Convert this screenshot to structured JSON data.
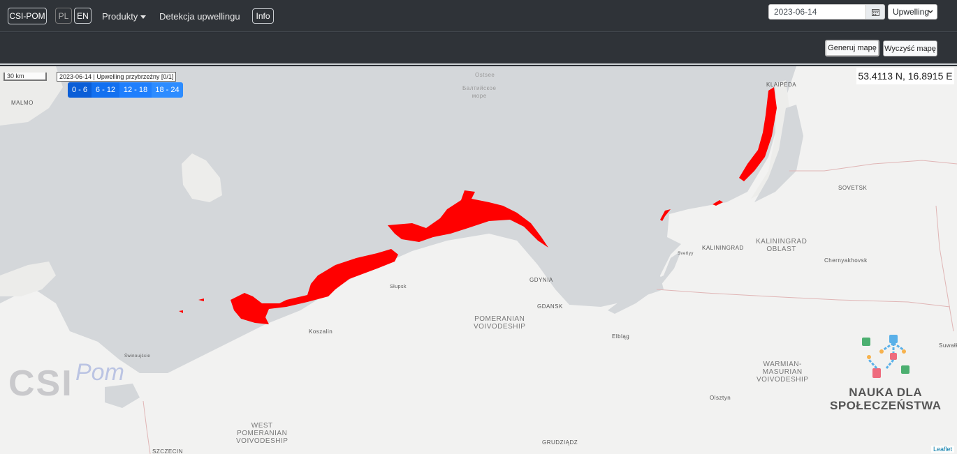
{
  "navbar": {
    "brand": "CSI-POM",
    "lang_pl": "PL",
    "lang_en": "EN",
    "products": "Produkty",
    "detection": "Detekcja upwellingu",
    "info": "Info",
    "date_value": "2023-06-14",
    "select_value": "Upwelling"
  },
  "toolbar": {
    "generate": "Generuj mapę",
    "clear": "Wyczyść mapę"
  },
  "map": {
    "scale": "30 km",
    "legend_title": "2023-06-14 | Upwelling przybrzeżny [0/1]",
    "legend_items": [
      "0 - 6",
      "6 - 12",
      "12 - 18",
      "18 - 24"
    ],
    "legend_colors": [
      "#0b5ed7",
      "#1270f0",
      "#1f7ffd",
      "#2d8cff"
    ],
    "coords": "53.4113 N, 16.8915 E",
    "upwelling_color": "#ff0000",
    "labels": {
      "ostsee": "Ostsee",
      "baltic_ru": "Балтийское\nморе",
      "malmo": "MALMO",
      "klaipeda": "KLAIPĖDA",
      "sovetsk": "SOVETSK",
      "kaliningrad": "KALININGRAD",
      "kaliningrad_oblast": "KALININGRAD\nOBLAST",
      "chernyakhovsk": "Chernyakhovsk",
      "svetly": "Svetlyy",
      "gdynia": "GDYNIA",
      "gdansk": "GDANSK",
      "slupsk": "Słupsk",
      "koszalin": "Koszalin",
      "pomeranian": "POMERANIAN\nVOIVODESHIP",
      "elblag": "Elbląg",
      "warmian": "WARMIAN-\nMASURIAN\nVOIVODESHIP",
      "olsztyn": "Olsztyn",
      "suwalki": "Suwałki",
      "west_pomeranian": "WEST\nPOMERANIAN\nVOIVODESHIP",
      "szczecin": "SZCZECIN",
      "grudziadz": "GRUDZIĄDZ",
      "swinoujscie": "Świnoujście"
    },
    "watermark_csi": "CSI",
    "watermark_pom": "Pom",
    "nauka": "NAUKA DLA\nSPOŁECZEŃSTWA",
    "attribution": "Leaflet"
  }
}
